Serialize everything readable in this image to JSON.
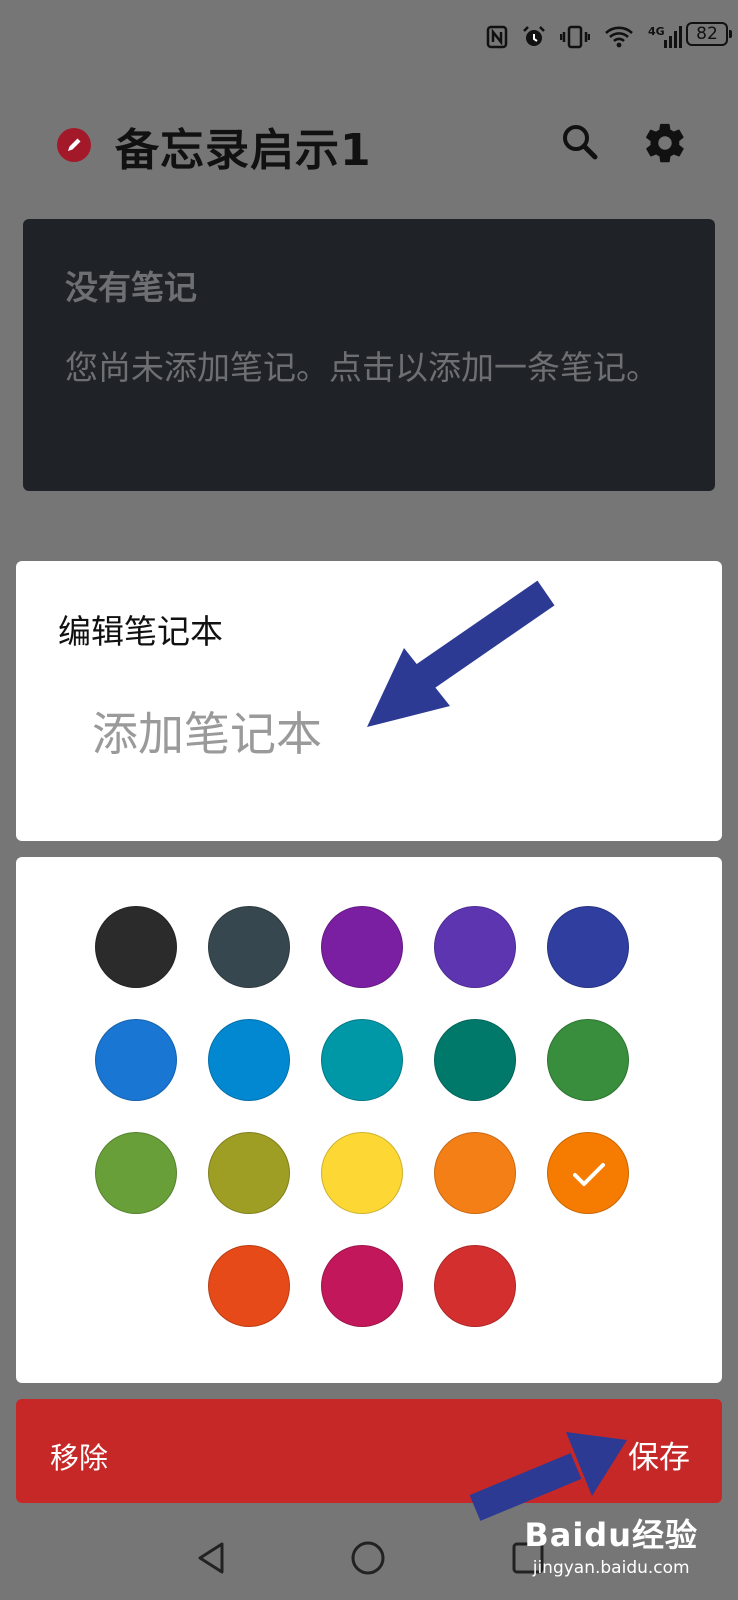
{
  "status_bar": {
    "icons": [
      "nfc-icon",
      "alarm-icon",
      "vibrate-icon",
      "wifi-icon",
      "signal-4g-icon"
    ],
    "battery": "82"
  },
  "app_bar": {
    "title": "备忘录启示1",
    "logo_color": "#a3192a"
  },
  "empty_state": {
    "title": "没有笔记",
    "description": "您尚未添加笔记。点击以添加一条笔记。"
  },
  "edit_dialog": {
    "title": "编辑笔记本",
    "input_placeholder": "添加笔记本",
    "input_value": ""
  },
  "color_palette": {
    "colors": [
      "#2b2b2b",
      "#37474f",
      "#7b1fa2",
      "#5e35b1",
      "#303f9f",
      "#1976d2",
      "#0288d1",
      "#0097a7",
      "#00796b",
      "#388e3c",
      "#689f38",
      "#9e9d24",
      "#fdd835",
      "#f57f17",
      "#f57c00",
      "#e64a19",
      "#c2185b",
      "#d32f2f"
    ],
    "selected_index": 14
  },
  "actions": {
    "remove_label": "移除",
    "save_label": "保存",
    "bar_color": "#c62828"
  },
  "watermark": {
    "brand": "Baidu经验",
    "url": "jingyan.baidu.com"
  }
}
